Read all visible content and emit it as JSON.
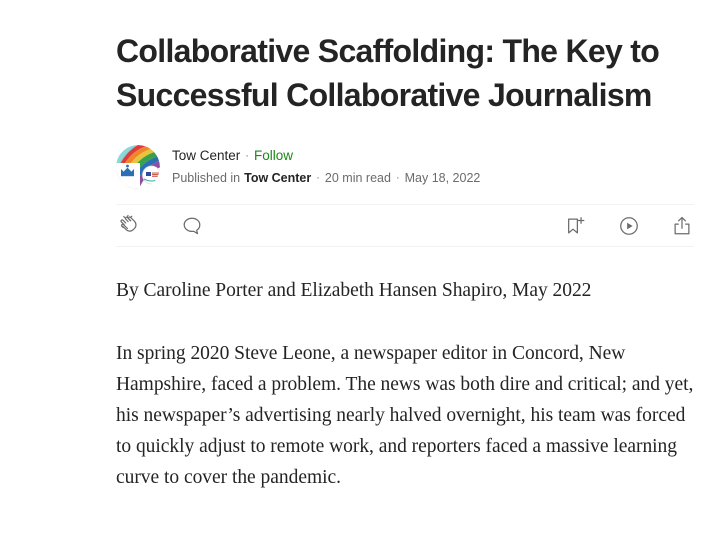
{
  "article": {
    "title": "Collaborative Scaffolding: The Key to Successful Collaborative Journalism",
    "byline": {
      "avatar_icon": "tow-center-logo-avatar",
      "author_name": "Tow Center",
      "separator": "·",
      "follow_label": "Follow",
      "published_in_label": "Published in",
      "publication_name": "Tow Center",
      "read_time": "20 min read",
      "publish_date": "May 18, 2022"
    },
    "actions": {
      "clap": "clap-icon",
      "comment": "comment-icon",
      "bookmark": "bookmark-plus-icon",
      "listen": "play-circle-icon",
      "share": "share-icon"
    },
    "body": [
      "By Caroline Porter and Elizabeth Hansen Shapiro, May 2022",
      "In spring 2020 Steve Leone, a newspaper editor in Concord, New Hampshire, faced a problem. The news was both dire and critical; and yet, his newspaper’s advertising nearly halved overnight, his team was forced to quickly adjust to remote work, and reporters faced a massive learning curve to cover the pandemic."
    ]
  },
  "colors": {
    "text_primary": "#242424",
    "text_secondary": "#6b6b6b",
    "accent_green": "#1a8917",
    "divider": "#f2f2f2",
    "background": "#ffffff"
  }
}
